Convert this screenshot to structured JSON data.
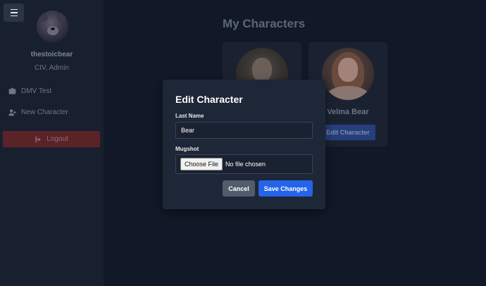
{
  "sidebar": {
    "menu_icon": "hamburger-icon",
    "avatar_icon": "bear-avatar",
    "username": "thestoicbear",
    "role": "CIV, Admin",
    "items": [
      {
        "label": "DMV Test",
        "icon": "id-card-icon"
      },
      {
        "label": "New Character",
        "icon": "user-plus-icon"
      }
    ],
    "logout_label": "Logout",
    "logout_icon": "sign-out-icon"
  },
  "main": {
    "title": "My Characters",
    "cards": [
      {
        "name": "",
        "button_label": ""
      },
      {
        "name": "Velma Bear",
        "button_label": "Edit Character"
      }
    ]
  },
  "modal": {
    "title": "Edit Character",
    "last_name_label": "Last Name",
    "last_name_value": "Bear",
    "mugshot_label": "Mugshot",
    "choose_file_label": "Choose File",
    "file_status": "No file chosen",
    "cancel_label": "Cancel",
    "save_label": "Save Changes"
  },
  "colors": {
    "background": "#111827",
    "sidebar": "#18202f",
    "modal": "#1e2737",
    "primary": "#2563eb",
    "logout": "#5a2328"
  }
}
